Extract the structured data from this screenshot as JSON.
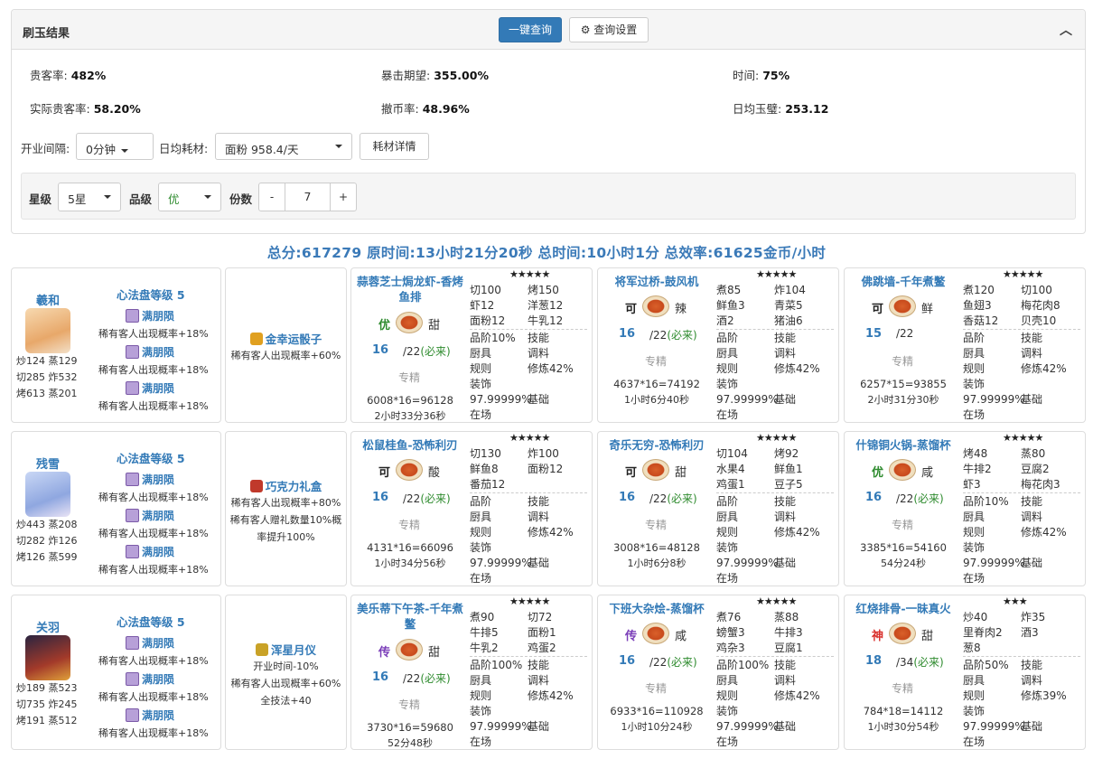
{
  "panel": {
    "title": "刷玉结果",
    "query_btn": "一键查询",
    "settings_btn": "查询设置",
    "collapse_icon": "chevron-up-icon",
    "settings_icon": "gear-icon"
  },
  "stats": {
    "r1": [
      {
        "label": "贵客率:",
        "value": "482%"
      },
      {
        "label": "暴击期望:",
        "value": "355.00%"
      },
      {
        "label": "时间:",
        "value": "75%"
      }
    ],
    "r2": [
      {
        "label": "实际贵客率:",
        "value": "58.20%"
      },
      {
        "label": "撤币率:",
        "value": "48.96%"
      },
      {
        "label": "日均玉璧:",
        "value": "253.12"
      }
    ]
  },
  "controls": {
    "interval_label": "开业间隔:",
    "interval_value": "0分钟",
    "material_label": "日均耗材:",
    "material_value": "面粉 958.4/天",
    "material_btn": "耗材详情"
  },
  "filters": {
    "star_label": "星级",
    "star_value": "5星",
    "grade_label": "品级",
    "grade_value": "优",
    "count_label": "份数",
    "minus": "-",
    "count_value": "7",
    "plus": "+"
  },
  "summary": "总分:617279 原时间:13小时21分20秒 总时间:10小时1分 总效率:61625金币/小时",
  "rows": [
    {
      "chef": {
        "name": "羲和",
        "stats": [
          "炒124 蒸129",
          "切285 炸532",
          "烤613 蒸201"
        ],
        "xinfa": "心法盘等级 5",
        "skills": [
          {
            "name": "满朋陨",
            "effect": "稀有客人出现概率+18%"
          },
          {
            "name": "满朋陨",
            "effect": "稀有客人出现概率+18%"
          },
          {
            "name": "满朋陨",
            "effect": "稀有客人出现概率+18%"
          }
        ]
      },
      "item": {
        "name": "金幸运骰子",
        "lines": [
          "稀有客人出现概率+60%"
        ],
        "color": "#e0a020"
      },
      "dishes": [
        {
          "name": [
            "蒜蓉芝士焗龙虾-香烤",
            "鱼排"
          ],
          "stars": "★★★★★",
          "grade": "优",
          "grade_color": "#2e8b2e",
          "flavor": "甜",
          "cnt": "16",
          "need": "/22",
          "need_tag": "(必来)",
          "spec": "专精",
          "calc": "6008*16=96128",
          "time": "2小时33分36秒",
          "mat": [
            [
              "切100",
              "烤150"
            ],
            [
              "虾12",
              "洋葱12"
            ],
            [
              "面粉12",
              "牛乳12"
            ]
          ]
        },
        {
          "name": [
            "将军过桥-鼓风机"
          ],
          "stars": "★★★★★",
          "grade": "可",
          "grade_color": "#222",
          "flavor": "辣",
          "cnt": "16",
          "need": "/22",
          "need_tag": "(必来)",
          "spec": "专精",
          "calc": "4637*16=74192",
          "time": "1小时6分40秒",
          "mat": [
            [
              "煮85",
              "炸104"
            ],
            [
              "鲜鱼3",
              "青菜5"
            ],
            [
              "酒2",
              "猪油6"
            ]
          ]
        },
        {
          "name": [
            "佛跳墙-千年煮鳖"
          ],
          "stars": "★★★★★",
          "grade": "可",
          "grade_color": "#222",
          "flavor": "鲜",
          "cnt": "15",
          "need": "/22",
          "need_tag": "",
          "spec": "专精",
          "calc": "6257*15=93855",
          "time": "2小时31分30秒",
          "mat": [
            [
              "煮120",
              "切100"
            ],
            [
              "鱼翅3",
              "梅花肉8"
            ],
            [
              "香菇12",
              "贝壳10"
            ]
          ]
        }
      ]
    },
    {
      "chef": {
        "name": "残雪",
        "stats": [
          "炒443 蒸208",
          "切282 炸126",
          "烤126 蒸599"
        ],
        "xinfa": "心法盘等级 5",
        "skills": [
          {
            "name": "满朋陨",
            "effect": "稀有客人出现概率+18%"
          },
          {
            "name": "满朋陨",
            "effect": "稀有客人出现概率+18%"
          },
          {
            "name": "满朋陨",
            "effect": "稀有客人出现概率+18%"
          }
        ]
      },
      "item": {
        "name": "巧克力礼盒",
        "lines": [
          "稀有客人出现概率+80%",
          "稀有客人赠礼数量10%概",
          "率提升100%"
        ],
        "color": "#c0392b"
      },
      "dishes": [
        {
          "name": [
            "松鼠桂鱼-恐怖利刃"
          ],
          "stars": "★★★★★",
          "grade": "可",
          "grade_color": "#222",
          "flavor": "酸",
          "cnt": "16",
          "need": "/22",
          "need_tag": "(必来)",
          "spec": "专精",
          "calc": "4131*16=66096",
          "time": "1小时34分56秒",
          "mat": [
            [
              "切130",
              "炸100"
            ],
            [
              "鲜鱼8",
              "面粉12"
            ],
            [
              "番茄12",
              ""
            ]
          ]
        },
        {
          "name": [
            "奇乐无穷-恐怖利刃"
          ],
          "stars": "★★★★★",
          "grade": "可",
          "grade_color": "#222",
          "flavor": "甜",
          "cnt": "16",
          "need": "/22",
          "need_tag": "(必来)",
          "spec": "专精",
          "calc": "3008*16=48128",
          "time": "1小时6分8秒",
          "mat": [
            [
              "切104",
              "烤92"
            ],
            [
              "水果4",
              "鲜鱼1"
            ],
            [
              "鸡蛋1",
              "豆子5"
            ]
          ]
        },
        {
          "name": [
            "什锦铜火锅-蒸馏杯"
          ],
          "stars": "★★★★★",
          "grade": "优",
          "grade_color": "#2e8b2e",
          "flavor": "咸",
          "cnt": "16",
          "need": "/22",
          "need_tag": "(必来)",
          "spec": "专精",
          "calc": "3385*16=54160",
          "time": "54分24秒",
          "mat": [
            [
              "烤48",
              "蒸80"
            ],
            [
              "牛排2",
              "豆腐2"
            ],
            [
              "虾3",
              "梅花肉3"
            ]
          ]
        }
      ]
    },
    {
      "chef": {
        "name": "关羽",
        "stats": [
          "炒189 蒸523",
          "切735 炸245",
          "烤191 蒸512"
        ],
        "xinfa": "心法盘等级 5",
        "skills": [
          {
            "name": "满朋陨",
            "effect": "稀有客人出现概率+18%"
          },
          {
            "name": "满朋陨",
            "effect": "稀有客人出现概率+18%"
          },
          {
            "name": "满朋陨",
            "effect": "稀有客人出现概率+18%"
          }
        ]
      },
      "item": {
        "name": "浑星月仪",
        "lines": [
          "开业时间-10%",
          "稀有客人出现概率+60%",
          "全技法+40"
        ],
        "color": "#c9a227"
      },
      "dishes": [
        {
          "name": [
            "美乐蒂下午茶-千年煮",
            "鳖"
          ],
          "stars": "★★★★★",
          "grade": "传",
          "grade_color": "#7a3db8",
          "flavor": "甜",
          "cnt": "16",
          "need": "/22",
          "need_tag": "(必来)",
          "spec": "专精",
          "calc": "3730*16=59680",
          "time": "52分48秒",
          "mat": [
            [
              "煮90",
              "切72"
            ],
            [
              "牛排5",
              "面粉1"
            ],
            [
              "牛乳2",
              "鸡蛋2"
            ]
          ]
        },
        {
          "name": [
            "下班大杂烩-蒸馏杯"
          ],
          "stars": "★★★★★",
          "grade": "传",
          "grade_color": "#7a3db8",
          "flavor": "咸",
          "cnt": "16",
          "need": "/22",
          "need_tag": "(必来)",
          "spec": "专精",
          "calc": "6933*16=110928",
          "time": "1小时10分24秒",
          "mat": [
            [
              "煮76",
              "蒸88"
            ],
            [
              "螃蟹3",
              "牛排3"
            ],
            [
              "鸡杂3",
              "豆腐1"
            ]
          ]
        },
        {
          "name": [
            "红烧排骨-一昧真火"
          ],
          "stars": "★★★",
          "grade": "神",
          "grade_color": "#d9302c",
          "flavor": "甜",
          "cnt": "18",
          "need": "/34",
          "need_tag": "(必来)",
          "spec": "专精",
          "calc": "784*18=14112",
          "time": "1小时30分54秒",
          "mat": [
            [
              "炒40",
              "炸35"
            ],
            [
              "里脊肉2",
              "酒3"
            ],
            [
              "葱8",
              ""
            ]
          ]
        }
      ]
    }
  ],
  "dish_bottom": {
    "std": {
      "labels": [
        [
          "品阶",
          "技能"
        ],
        [
          "厨具",
          "调料"
        ],
        [
          "规则",
          "修炼42%"
        ],
        [
          "装饰",
          ""
        ],
        [
          "97.99999%",
          "基础"
        ],
        [
          "在场",
          ""
        ]
      ]
    },
    "alt": [
      [
        [
          [
            "品阶10%",
            "技能"
          ],
          [
            "厨具",
            "调料"
          ],
          [
            "规则",
            "修炼42%"
          ],
          [
            "装饰",
            ""
          ],
          [
            "97.99999%",
            "基础"
          ],
          [
            "在场",
            ""
          ]
        ],
        [
          [
            "品阶",
            "技能"
          ],
          [
            "厨具",
            "调料"
          ],
          [
            "规则",
            "修炼42%"
          ],
          [
            "装饰",
            ""
          ],
          [
            "97.99999%",
            "基础"
          ],
          [
            "在场",
            ""
          ]
        ],
        [
          [
            "品阶",
            "技能"
          ],
          [
            "厨具",
            "调料"
          ],
          [
            "规则",
            "修炼42%"
          ],
          [
            "装饰",
            ""
          ],
          [
            "97.99999%",
            "基础"
          ],
          [
            "在场",
            ""
          ]
        ]
      ],
      [
        [
          [
            "品阶",
            "技能"
          ],
          [
            "厨具",
            "调料"
          ],
          [
            "规则",
            "修炼42%"
          ],
          [
            "装饰",
            ""
          ],
          [
            "97.99999%",
            "基础"
          ],
          [
            "在场",
            ""
          ]
        ],
        [
          [
            "品阶",
            "技能"
          ],
          [
            "厨具",
            "调料"
          ],
          [
            "规则",
            "修炼42%"
          ],
          [
            "装饰",
            ""
          ],
          [
            "97.99999%",
            "基础"
          ],
          [
            "在场",
            ""
          ]
        ],
        [
          [
            "品阶10%",
            "技能"
          ],
          [
            "厨具",
            "调料"
          ],
          [
            "规则",
            "修炼42%"
          ],
          [
            "装饰",
            ""
          ],
          [
            "97.99999%",
            "基础"
          ],
          [
            "在场",
            ""
          ]
        ]
      ],
      [
        [
          [
            "品阶100%",
            "技能"
          ],
          [
            "厨具",
            "调料"
          ],
          [
            "规则",
            "修炼42%"
          ],
          [
            "装饰",
            ""
          ],
          [
            "97.99999%",
            "基础"
          ],
          [
            "在场",
            ""
          ]
        ],
        [
          [
            "品阶100%",
            "技能"
          ],
          [
            "厨具",
            "调料"
          ],
          [
            "规则",
            "修炼42%"
          ],
          [
            "装饰",
            ""
          ],
          [
            "97.99999%",
            "基础"
          ],
          [
            "在场",
            ""
          ]
        ],
        [
          [
            "品阶50%",
            "技能"
          ],
          [
            "厨具",
            "调料"
          ],
          [
            "规则",
            "修炼39%"
          ],
          [
            "装饰",
            ""
          ],
          [
            "97.99999%",
            "基础"
          ],
          [
            "在场",
            ""
          ]
        ]
      ]
    ]
  }
}
